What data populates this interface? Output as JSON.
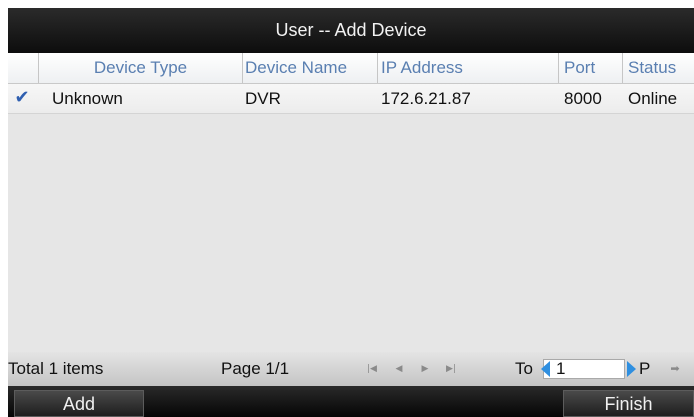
{
  "title": "User -- Add Device",
  "table": {
    "columns": [
      "Device Type",
      "Device Name",
      "IP Address",
      "Port",
      "Status"
    ],
    "rows": [
      {
        "checked": true,
        "device_type": "Unknown",
        "device_name": "DVR",
        "ip_address": "172.6.21.87",
        "port": "8000",
        "status": "Online"
      }
    ]
  },
  "footer": {
    "total": "Total 1 items",
    "page": "Page 1/1",
    "to_label": "To",
    "page_input": "1",
    "page_suffix": "P",
    "icons": [
      "first-page-icon",
      "prev-page-icon",
      "next-page-icon",
      "last-page-icon",
      "go-arrow-icon"
    ]
  },
  "buttons": {
    "add": "Add",
    "finish": "Finish"
  },
  "colors": {
    "header_text": "#5a7fb1",
    "check": "#2f5fb0",
    "spin_arrow": "#2f8fe0"
  }
}
